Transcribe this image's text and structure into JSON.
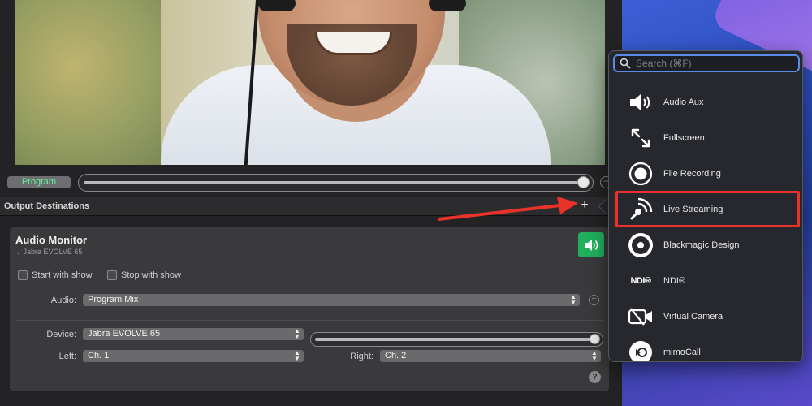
{
  "program": {
    "label": "Program"
  },
  "output_destinations": {
    "title": "Output Destinations",
    "add_glyph": "+"
  },
  "audio_monitor": {
    "title": "Audio Monitor",
    "device_summary": "Jabra EVOLVE 65",
    "start_with_show": "Start with show",
    "stop_with_show": "Stop with show",
    "audio_label": "Audio:",
    "audio_value": "Program Mix",
    "device_label": "Device:",
    "device_value": "Jabra EVOLVE 65",
    "left_label": "Left:",
    "left_value": "Ch. 1",
    "right_label": "Right:",
    "right_value": "Ch. 2",
    "help_glyph": "?",
    "speaker_color": "#20b05c"
  },
  "popup": {
    "search_placeholder": "Search (⌘F)",
    "items": [
      {
        "label": "Audio Aux",
        "icon": "speaker-icon"
      },
      {
        "label": "Fullscreen",
        "icon": "fullscreen-icon"
      },
      {
        "label": "File Recording",
        "icon": "record-icon"
      },
      {
        "label": "Live Streaming",
        "icon": "live-streaming-icon"
      },
      {
        "label": "Blackmagic Design",
        "icon": "blackmagic-icon"
      },
      {
        "label": "NDI®",
        "icon": "ndi-icon",
        "icon_text": "NDI®"
      },
      {
        "label": "Virtual Camera",
        "icon": "virtual-camera-icon"
      },
      {
        "label": "mimoCall",
        "icon": "mimocall-icon"
      }
    ],
    "highlight_color": "#e8322a"
  }
}
